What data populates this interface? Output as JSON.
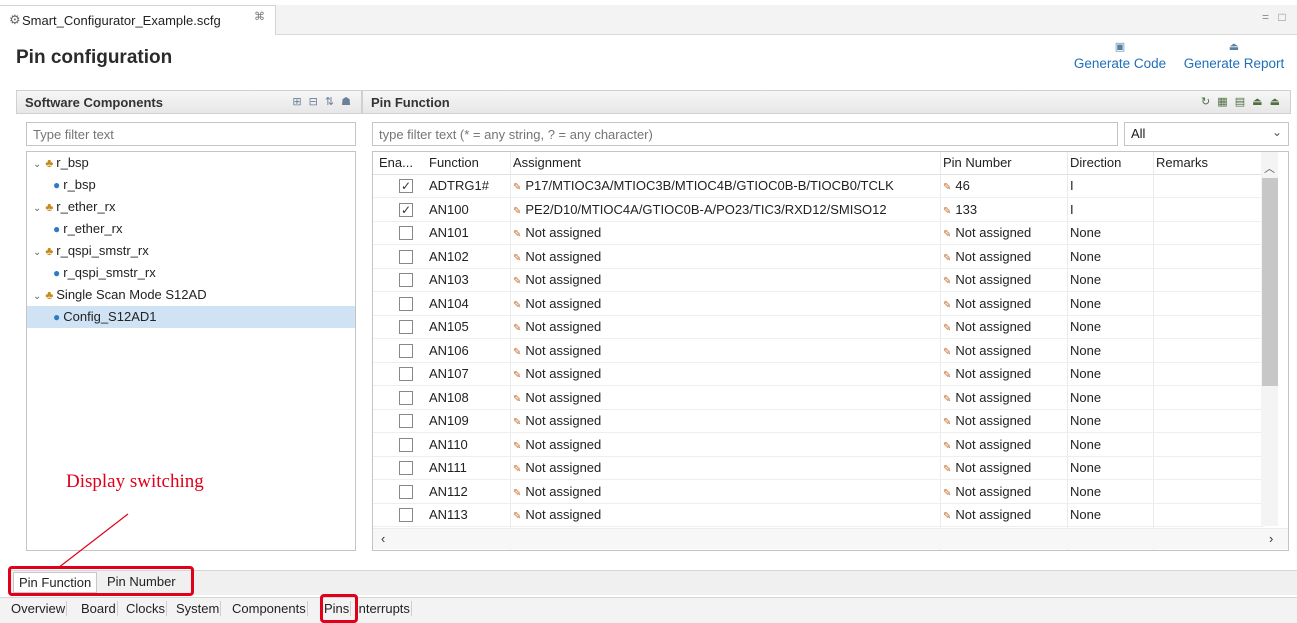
{
  "editor": {
    "tab_title": "Smart_Configurator_Example.scfg",
    "close_glyph": "⌘",
    "window_controls": "= □"
  },
  "page_title": "Pin configuration",
  "actions": {
    "generate_code": "Generate Code",
    "generate_report": "Generate Report"
  },
  "software_components": {
    "title": "Software Components",
    "filter_placeholder": "Type filter text",
    "tree": [
      {
        "label": "r_bsp",
        "level": 0,
        "icon": "component-icon",
        "expanded": true
      },
      {
        "label": "r_bsp",
        "level": 1,
        "icon": "config-icon"
      },
      {
        "label": "r_ether_rx",
        "level": 0,
        "icon": "component-icon",
        "expanded": true
      },
      {
        "label": "r_ether_rx",
        "level": 1,
        "icon": "config-icon"
      },
      {
        "label": "r_qspi_smstr_rx",
        "level": 0,
        "icon": "component-icon",
        "expanded": true
      },
      {
        "label": "r_qspi_smstr_rx",
        "level": 1,
        "icon": "config-icon"
      },
      {
        "label": "Single Scan Mode S12AD",
        "level": 0,
        "icon": "component-icon",
        "expanded": true
      },
      {
        "label": "Config_S12AD1",
        "level": 1,
        "icon": "config-icon",
        "selected": true
      }
    ]
  },
  "pin_function": {
    "title": "Pin Function",
    "filter_placeholder": "type filter text (* = any string, ? = any character)",
    "filter_select": "All",
    "columns": [
      "Ena...",
      "Function",
      "Assignment",
      "Pin Number",
      "Direction",
      "Remarks"
    ],
    "rows": [
      {
        "enabled": true,
        "function": "ADTRG1#",
        "assignment": "P17/MTIOC3A/MTIOC3B/MTIOC4B/GTIOC0B-B/TIOCB0/TCLK",
        "pin": "46",
        "direction": "I",
        "remarks": ""
      },
      {
        "enabled": true,
        "function": "AN100",
        "assignment": "PE2/D10/MTIOC4A/GTIOC0B-A/PO23/TIC3/RXD12/SMISO12",
        "pin": "133",
        "direction": "I",
        "remarks": ""
      },
      {
        "enabled": false,
        "function": "AN101",
        "assignment": "Not assigned",
        "pin": "Not assigned",
        "direction": "None",
        "remarks": ""
      },
      {
        "enabled": false,
        "function": "AN102",
        "assignment": "Not assigned",
        "pin": "Not assigned",
        "direction": "None",
        "remarks": ""
      },
      {
        "enabled": false,
        "function": "AN103",
        "assignment": "Not assigned",
        "pin": "Not assigned",
        "direction": "None",
        "remarks": ""
      },
      {
        "enabled": false,
        "function": "AN104",
        "assignment": "Not assigned",
        "pin": "Not assigned",
        "direction": "None",
        "remarks": ""
      },
      {
        "enabled": false,
        "function": "AN105",
        "assignment": "Not assigned",
        "pin": "Not assigned",
        "direction": "None",
        "remarks": ""
      },
      {
        "enabled": false,
        "function": "AN106",
        "assignment": "Not assigned",
        "pin": "Not assigned",
        "direction": "None",
        "remarks": ""
      },
      {
        "enabled": false,
        "function": "AN107",
        "assignment": "Not assigned",
        "pin": "Not assigned",
        "direction": "None",
        "remarks": ""
      },
      {
        "enabled": false,
        "function": "AN108",
        "assignment": "Not assigned",
        "pin": "Not assigned",
        "direction": "None",
        "remarks": ""
      },
      {
        "enabled": false,
        "function": "AN109",
        "assignment": "Not assigned",
        "pin": "Not assigned",
        "direction": "None",
        "remarks": ""
      },
      {
        "enabled": false,
        "function": "AN110",
        "assignment": "Not assigned",
        "pin": "Not assigned",
        "direction": "None",
        "remarks": ""
      },
      {
        "enabled": false,
        "function": "AN111",
        "assignment": "Not assigned",
        "pin": "Not assigned",
        "direction": "None",
        "remarks": ""
      },
      {
        "enabled": false,
        "function": "AN112",
        "assignment": "Not assigned",
        "pin": "Not assigned",
        "direction": "None",
        "remarks": ""
      },
      {
        "enabled": false,
        "function": "AN113",
        "assignment": "Not assigned",
        "pin": "Not assigned",
        "direction": "None",
        "remarks": ""
      }
    ]
  },
  "display_tabs": [
    "Pin Function",
    "Pin Number"
  ],
  "main_tabs": [
    "Overview",
    "Board",
    "Clocks",
    "System",
    "Components",
    "Pins",
    "Interrupts"
  ],
  "annotation": "Display switching",
  "colors": {
    "annotation": "#e0001a",
    "link": "#1f6fba",
    "selection": "#cfe3f5"
  }
}
